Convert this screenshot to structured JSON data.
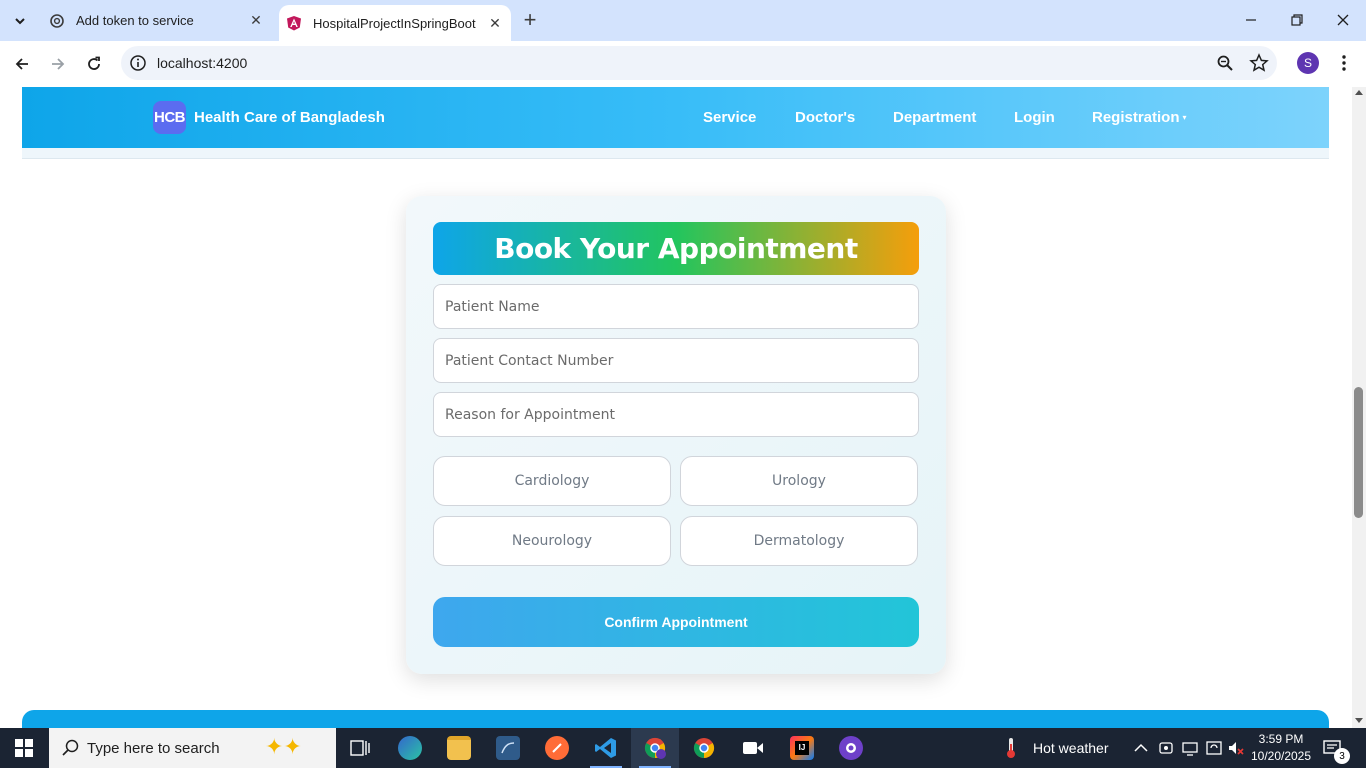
{
  "browser": {
    "tabs": [
      {
        "title": "Add token to service",
        "active": false,
        "icon": "openai-icon"
      },
      {
        "title": "HospitalProjectInSpringBoot",
        "active": true,
        "icon": "angular-icon"
      }
    ],
    "address": "localhost:4200",
    "profile_initial": "S"
  },
  "navbar": {
    "logo_text": "HCB",
    "brand": "Health Care of Bangladesh",
    "links": [
      "Service",
      "Doctor's",
      "Department",
      "Login"
    ],
    "dropdown": {
      "label": "Registration",
      "caret": "▾"
    },
    "gradient": [
      "#0ea5e9",
      "#7dd3fc"
    ]
  },
  "form": {
    "title": "Book Your Appointment",
    "title_gradient": [
      "#0ea5e9",
      "#22c55e",
      "#f59e0b"
    ],
    "fields": [
      {
        "placeholder": "Patient Name",
        "value": ""
      },
      {
        "placeholder": "Patient Contact Number",
        "value": ""
      },
      {
        "placeholder": "Reason for Appointment",
        "value": ""
      }
    ],
    "departments": [
      "Cardiology",
      "Urology",
      "Neourology",
      "Dermatology"
    ],
    "submit_label": "Confirm Appointment"
  },
  "taskbar": {
    "search_placeholder": "Type here to search",
    "apps": [
      "task-view-icon",
      "edge-icon",
      "file-explorer-icon",
      "mysql-workbench-icon",
      "postman-icon",
      "vscode-icon",
      "chrome-profile-icon",
      "chrome-icon",
      "video-icon",
      "intellij-icon",
      "github-icon"
    ],
    "weather": "Hot weather",
    "time": "3:59 PM",
    "date": "10/20/2025",
    "notification_count": "3"
  }
}
